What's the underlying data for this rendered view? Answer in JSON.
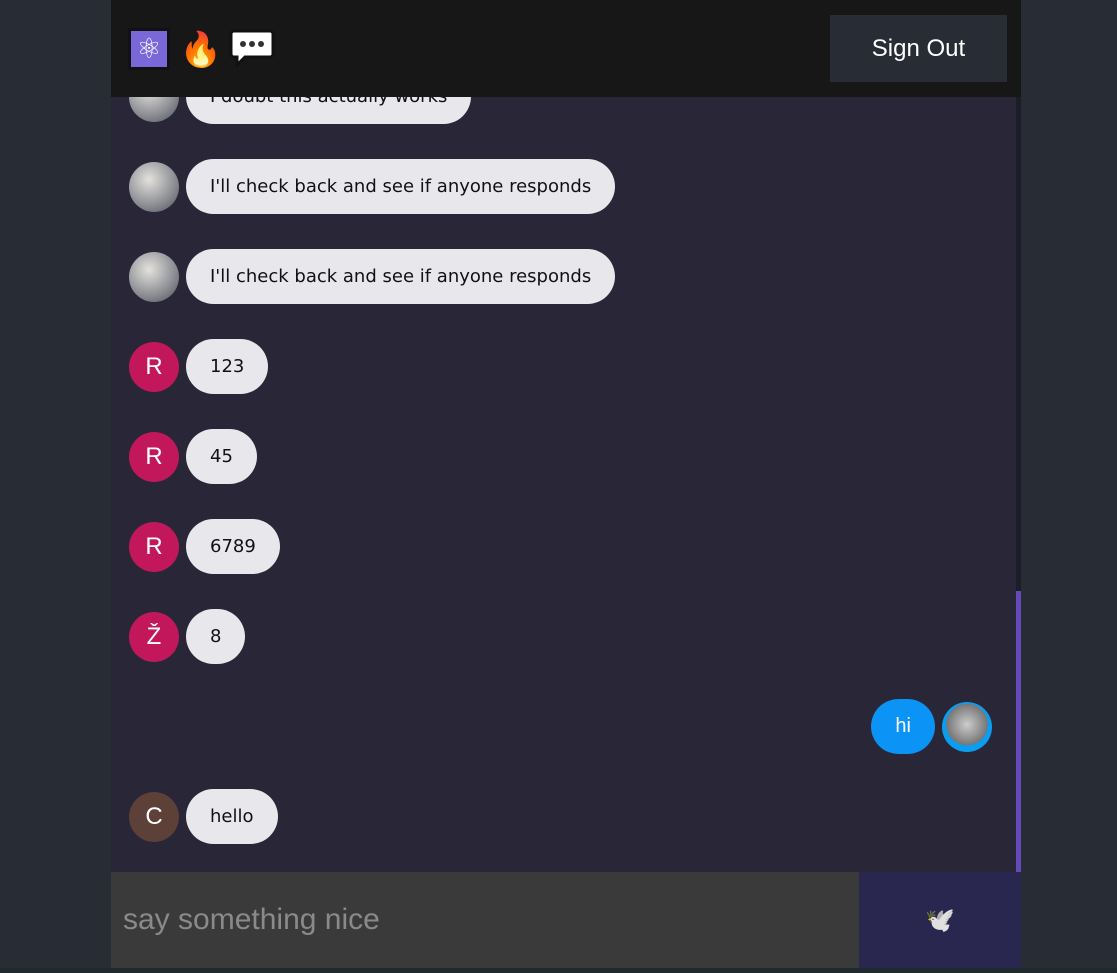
{
  "header": {
    "icons": [
      "atom-icon",
      "fire-icon",
      "speech-bubble-icon"
    ],
    "sign_out": "Sign Out"
  },
  "messages": [
    {
      "text": "I doubt this actually works",
      "avatar": "image",
      "sender": "other"
    },
    {
      "text": "I'll check back and see if anyone responds",
      "avatar": "image",
      "sender": "other"
    },
    {
      "text": "I'll check back and see if anyone responds",
      "avatar": "image",
      "sender": "other"
    },
    {
      "text": "123",
      "avatar": "R",
      "sender": "other"
    },
    {
      "text": "45",
      "avatar": "R",
      "sender": "other"
    },
    {
      "text": "6789",
      "avatar": "R",
      "sender": "other"
    },
    {
      "text": "8",
      "avatar": "Ž",
      "sender": "other"
    },
    {
      "text": "hi",
      "avatar": "image",
      "sender": "me"
    },
    {
      "text": "hello",
      "avatar": "C",
      "sender": "other"
    }
  ],
  "composer": {
    "placeholder": "say something nice",
    "value": "",
    "send_icon": "🕊️"
  },
  "colors": {
    "sent_bubble": "#0b93f6",
    "received_bubble": "#e8e7ec",
    "avatar_pink": "#c2185b",
    "avatar_brown": "#5d4037",
    "accent": "#6649b8"
  }
}
